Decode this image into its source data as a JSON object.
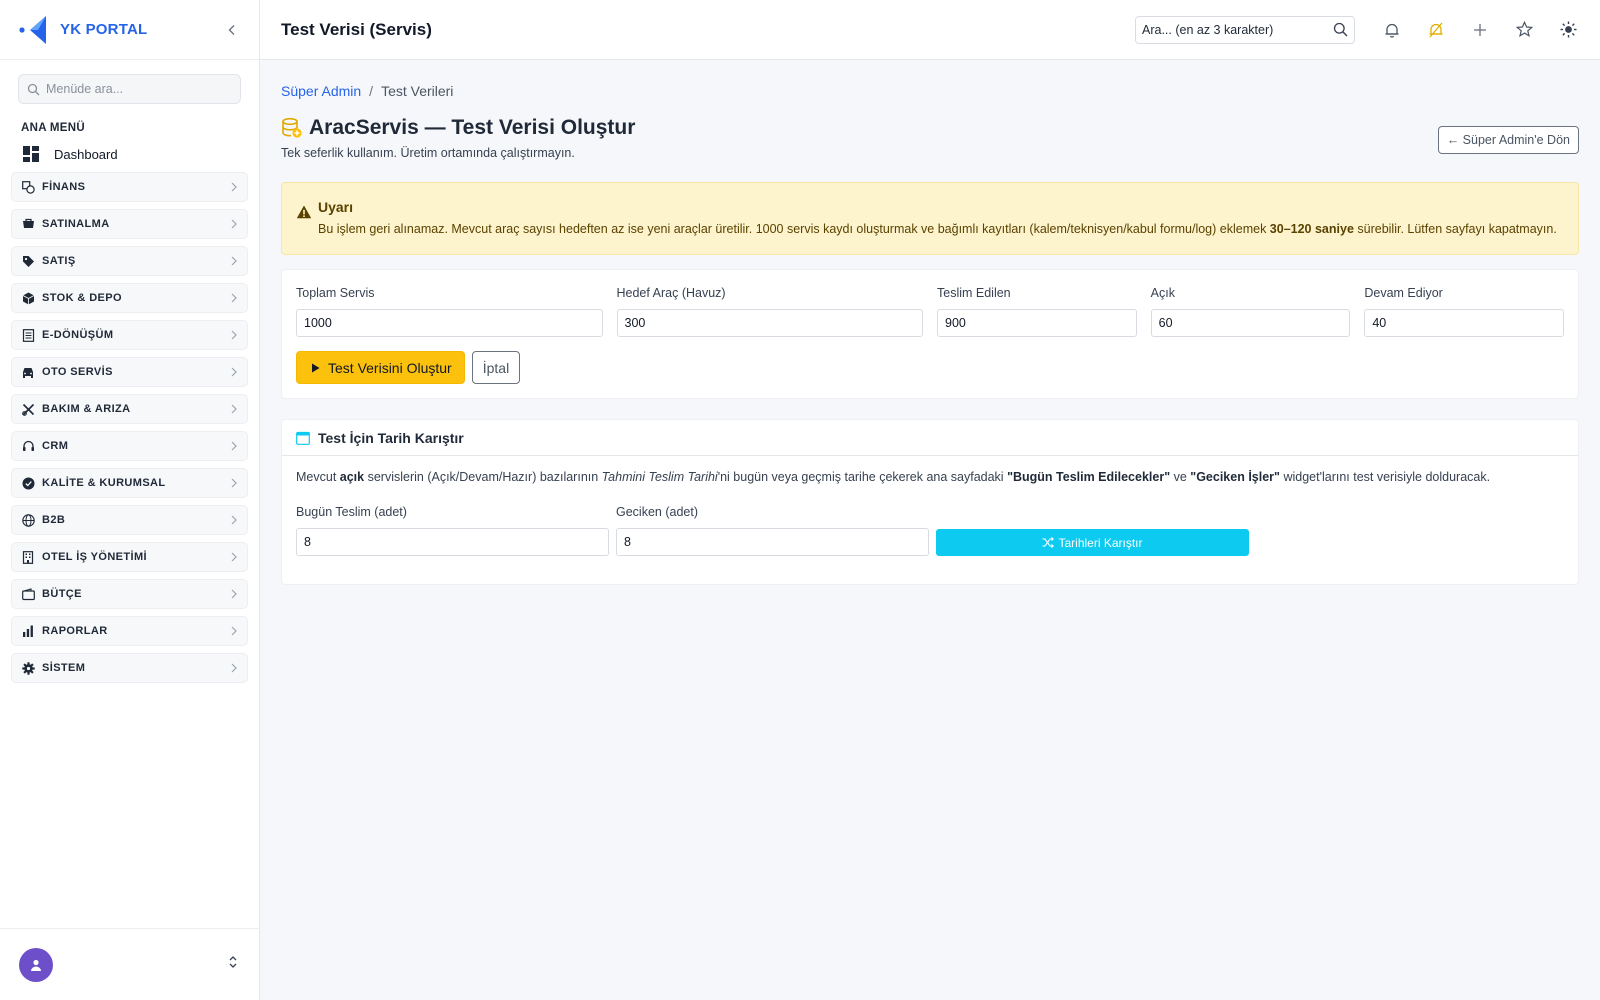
{
  "brand": {
    "name": "YK PORTAL"
  },
  "sidebar": {
    "search_placeholder": "Menüde ara...",
    "section_title": "ANA MENÜ",
    "dashboard_label": "Dashboard",
    "items": [
      {
        "label": "FİNANS",
        "icon": "finance-icon"
      },
      {
        "label": "SATINALMA",
        "icon": "cart-icon"
      },
      {
        "label": "SATIŞ",
        "icon": "tag-icon"
      },
      {
        "label": "STOK & DEPO",
        "icon": "box-icon"
      },
      {
        "label": "E-DÖNÜŞÜM",
        "icon": "document-icon"
      },
      {
        "label": "OTO SERVİS",
        "icon": "car-icon"
      },
      {
        "label": "BAKIM & ARIZA",
        "icon": "tools-icon"
      },
      {
        "label": "CRM",
        "icon": "headset-icon"
      },
      {
        "label": "KALİTE & KURUMSAL",
        "icon": "badge-icon"
      },
      {
        "label": "B2B",
        "icon": "globe-icon"
      },
      {
        "label": "OTEL İŞ YÖNETİMİ",
        "icon": "building-icon"
      },
      {
        "label": "BÜTÇE",
        "icon": "wallet-icon"
      },
      {
        "label": "RAPORLAR",
        "icon": "bar-chart-icon"
      },
      {
        "label": "SİSTEM",
        "icon": "gear-icon"
      }
    ]
  },
  "header": {
    "title": "Test Verisi (Servis)",
    "search_placeholder": "Ara... (en az 3 karakter)"
  },
  "breadcrumb": {
    "link": "Süper Admin",
    "separator": "/",
    "current": "Test Verileri"
  },
  "page": {
    "title": "AracServis — Test Verisi Oluştur",
    "subtitle": "Tek seferlik kullanım. Üretim ortamında çalıştırmayın.",
    "back_button": "← Süper Admin'e Dön"
  },
  "alert": {
    "title": "Uyarı",
    "text_before": "Bu işlem geri alınamaz. Mevcut araç sayısı hedeften az ise yeni araçlar üretilir. 1000 servis kaydı oluşturmak ve bağımlı kayıtları (kalem/teknisyen/kabul formu/log) eklemek ",
    "text_bold": "30–120 saniye",
    "text_after": " sürebilir. Lütfen sayfayı kapatmayın."
  },
  "form": {
    "fields": [
      {
        "label": "Toplam Servis",
        "value": "1000"
      },
      {
        "label": "Hedef Araç (Havuz)",
        "value": "300"
      },
      {
        "label": "Teslim Edilen",
        "value": "900"
      },
      {
        "label": "Açık",
        "value": "60"
      },
      {
        "label": "Devam Ediyor",
        "value": "40"
      }
    ],
    "submit_label": "Test Verisini Oluştur",
    "cancel_label": "İptal"
  },
  "mix": {
    "title": "Test İçin Tarih Karıştır",
    "desc": {
      "p1": "Mevcut ",
      "b1": "açık",
      "p2": " servislerin (Açık/Devam/Hazır) bazılarının ",
      "i1": "Tahmini Teslim Tarihi",
      "p3": "'ni bugün veya geçmiş tarihe çekerek ana sayfadaki ",
      "b2": "\"Bugün Teslim Edilecekler\"",
      "p4": " ve ",
      "b3": "\"Geciken İşler\"",
      "p5": " widget'larını test verisiyle dolduracak."
    },
    "fields": [
      {
        "label": "Bugün Teslim (adet)",
        "value": "8"
      },
      {
        "label": "Geciken (adet)",
        "value": "8"
      }
    ],
    "button_label": "Tarihleri Karıştır"
  },
  "colors": {
    "brand": "#2563eb",
    "primary_button": "#fcc10d",
    "info_button": "#0dcaf0",
    "alert_bg": "#fdf3cd",
    "avatar": "#6d4fc9"
  }
}
